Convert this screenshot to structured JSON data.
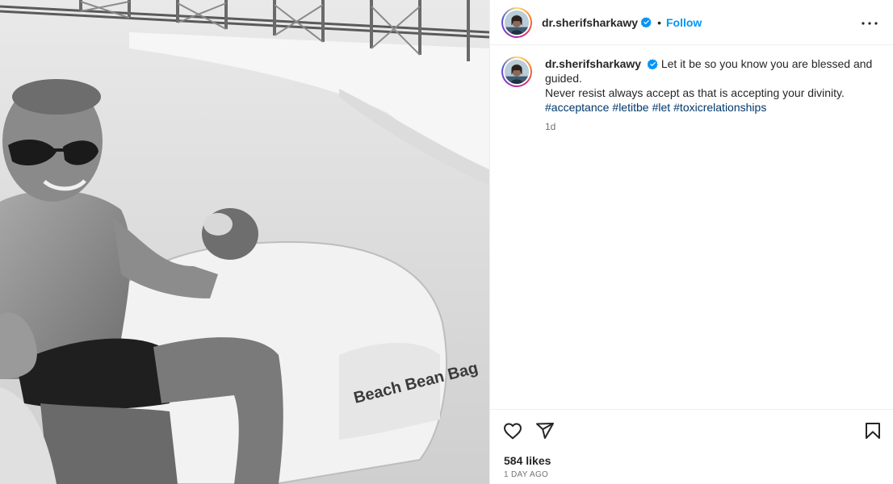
{
  "post": {
    "username": "dr.sherifsharkawy",
    "follow_label": "Follow",
    "separator": "•",
    "photo_alt_brand": "Beach Bean Bag",
    "caption": {
      "username": "dr.sherifsharkawy",
      "line1": "Let it be so you know you are blessed and guided.",
      "line2": "Never resist always accept as that is accepting your divinity.",
      "hashtags": [
        "#acceptance",
        "#letitbe",
        "#let",
        "#toxicrelationships"
      ],
      "time": "1d"
    },
    "likes": "584 likes",
    "date": "1 DAY AGO"
  },
  "icons": {
    "verified": "verified-badge-icon",
    "more": "more-options-icon",
    "like": "heart-icon",
    "share": "share-icon",
    "save": "bookmark-icon"
  },
  "colors": {
    "accent": "#0095f6",
    "verified": "#0095f6",
    "hashtag": "#00376b",
    "muted": "#737373"
  }
}
